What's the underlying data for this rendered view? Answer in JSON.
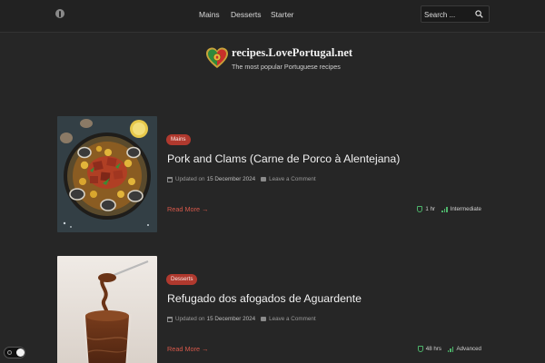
{
  "header": {
    "nav": [
      "Mains",
      "Desserts",
      "Starter"
    ],
    "search_placeholder": "Search ..."
  },
  "brand": {
    "title": "recipes.LovePortugal.net",
    "tagline": "The most popular Portuguese recipes"
  },
  "posts": [
    {
      "category": "Mains",
      "title": "Pork and Clams (Carne de Porco à Alentejana)",
      "updated_label": "Updated on",
      "updated_date": "15 December 2024",
      "comment_label": "Leave a Comment",
      "read_more": "Read More →",
      "time": "1 hr",
      "level": "Intermediate"
    },
    {
      "category": "Desserts",
      "title": "Refugado dos afogados de Aguardente",
      "updated_label": "Updated on",
      "updated_date": "15 December 2024",
      "comment_label": "Leave a Comment",
      "read_more": "Read More →",
      "time": "48 hrs",
      "level": "Advanced"
    }
  ],
  "colors": {
    "background": "#262626",
    "accent": "#b0392e",
    "link": "#d5584a",
    "stat_icon": "#4db36a"
  }
}
